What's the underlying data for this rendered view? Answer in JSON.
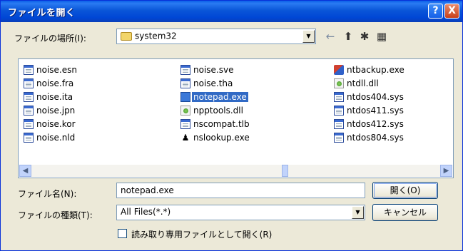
{
  "window": {
    "title": "ファイルを開く",
    "help_label": "?",
    "close_label": "X"
  },
  "look_in": {
    "label": "ファイルの場所(I):",
    "value": "system32"
  },
  "toolbar": {
    "back_icon": "←",
    "up_icon": "⬆",
    "new_folder_icon": "✱",
    "view_icon": "▦"
  },
  "files": {
    "col1": [
      "noise.esn",
      "noise.fra",
      "noise.ita",
      "noise.jpn",
      "noise.kor",
      "noise.nld"
    ],
    "col2": [
      "noise.sve",
      "noise.tha",
      "notepad.exe",
      "npptools.dll",
      "nscompat.tlb",
      "nslookup.exe"
    ],
    "col3": [
      "ntbackup.exe",
      "ntdll.dll",
      "ntdos404.sys",
      "ntdos411.sys",
      "ntdos412.sys",
      "ntdos804.sys"
    ],
    "selected": "notepad.exe"
  },
  "filename": {
    "label": "ファイル名(N):",
    "value": "notepad.exe"
  },
  "filetype": {
    "label": "ファイルの種類(T):",
    "value": "All Files(*.*)"
  },
  "buttons": {
    "open": "開く(O)",
    "cancel": "キャンセル"
  },
  "readonly": {
    "label": "読み取り専用ファイルとして開く(R)",
    "checked": false
  },
  "colors": {
    "title_bar": "#0a56d8",
    "dialog_bg": "#ece9d8",
    "selection": "#316ac5"
  }
}
